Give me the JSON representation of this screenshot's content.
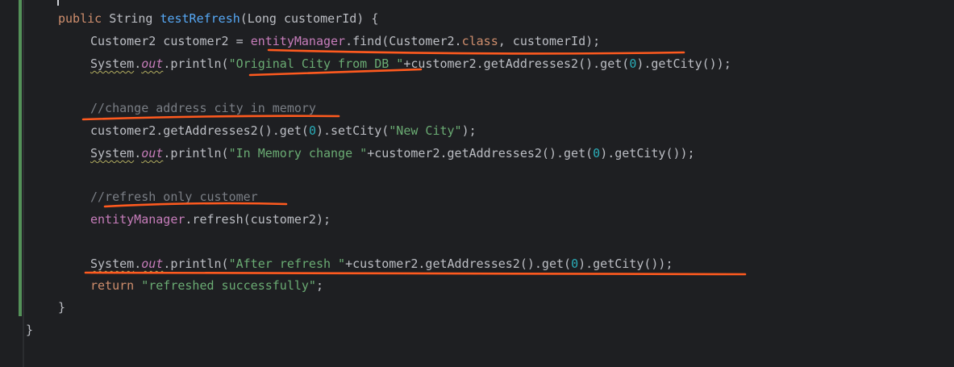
{
  "code": {
    "line1": {
      "kw_public": "public",
      "type": " String ",
      "method": "testRefresh",
      "params": "(Long customerId) {"
    },
    "line2": {
      "decl": "Customer2 customer2 = ",
      "field": "entityManager",
      "find": ".find(Customer2.",
      "kw_class": "class",
      "rest": ", customerId);"
    },
    "line3": {
      "system": "System",
      "dot": ".",
      "out": "out",
      "println": ".println(",
      "str": "\"Original City from DB \"",
      "mid": "+customer2.getAddresses2().get(",
      "num": "0",
      "end": ").getCity());"
    },
    "line4": {
      "comment": "//change address city in memory"
    },
    "line5": {
      "start": "customer2.getAddresses2().get(",
      "num": "0",
      "mid": ").setCity(",
      "str": "\"New City\"",
      "end": ");"
    },
    "line6": {
      "system": "System",
      "dot": ".",
      "out": "out",
      "println": ".println(",
      "str": "\"In Memory change \"",
      "mid": "+customer2.getAddresses2().get(",
      "num": "0",
      "end": ").getCity());"
    },
    "line7": {
      "comment": "//refresh only customer"
    },
    "line8": {
      "field": "entityManager",
      "rest": ".refresh(customer2);"
    },
    "line9": {
      "system": "System",
      "dot": ".",
      "out": "out",
      "println": ".println(",
      "str": "\"After refresh \"",
      "mid": "+customer2.getAddresses2().get(",
      "num": "0",
      "end": ").getCity());"
    },
    "line10": {
      "kw_return": "return",
      "space": " ",
      "str": "\"refreshed successfully\"",
      "end": ";"
    },
    "line11": {
      "brace": "}"
    },
    "line12": {
      "brace": "}"
    }
  },
  "colors": {
    "background": "#1e1f22",
    "keyword": "#cf8e6d",
    "method": "#56a8f5",
    "string": "#6aab73",
    "number": "#2aacb8",
    "field": "#c77dbb",
    "comment": "#7a7e85",
    "annotation_ink": "#ff5a1f",
    "vcs_change_marker": "#549159"
  }
}
